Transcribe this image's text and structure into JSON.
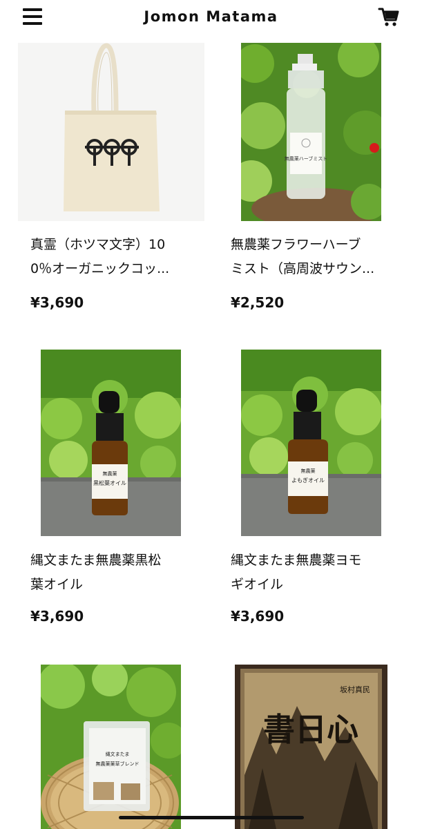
{
  "header": {
    "title": "Jomon Matama",
    "menu_icon": "hamburger-menu-icon",
    "cart_icon": "shopping-cart-icon"
  },
  "products": [
    {
      "name_line1": "真霊（ホツマ文字）10",
      "name_line2": "0％オーガニックコッ...",
      "price": "¥3,690",
      "image": "organic-cotton-tote-bag-with-hotsuma-glyphs"
    },
    {
      "name_line1": "無農薬フラワーハーブ",
      "name_line2": "ミスト（高周波サウン...",
      "price": "¥2,520",
      "image": "spray-bottle-in-greenery",
      "bottle_label": "無農薬ハーブミスト"
    },
    {
      "name_line1": "縄文またま無農薬黒松",
      "name_line2": "葉オイル",
      "price": "¥3,690",
      "image": "dropper-bottle-black-pine-oil",
      "bottle_label_line1": "無農薬",
      "bottle_label_line2": "黒松葉オイル"
    },
    {
      "name_line1": "縄文またま無農薬ヨモ",
      "name_line2": "ギオイル",
      "price": "¥3,690",
      "image": "dropper-bottle-yomogi-oil",
      "bottle_label_line1": "無農薬",
      "bottle_label_line2": "よもぎオイル"
    },
    {
      "image": "herbal-tea-bags-in-basket",
      "package_label_line1": "縄文またま",
      "package_label_line2": "無農薬薬草ブレンド"
    },
    {
      "image": "book-cover-sepia",
      "cover_title": "書日心",
      "cover_side": "坂村真民"
    }
  ],
  "colors": {
    "text": "#111111",
    "background": "#ffffff",
    "greenery": "#5a9a2a"
  }
}
